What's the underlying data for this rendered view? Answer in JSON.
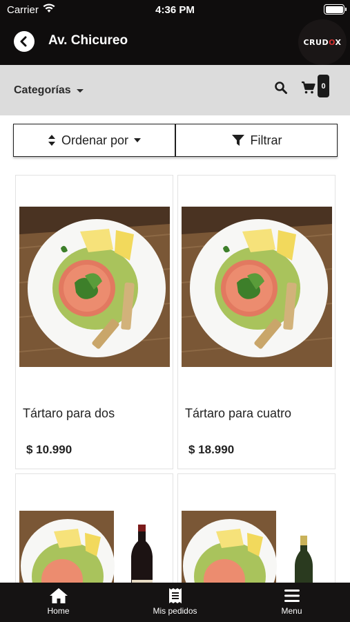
{
  "status": {
    "carrier": "Carrier",
    "time": "4:36 PM"
  },
  "header": {
    "title": "Av. Chicureo",
    "logo_main": "CRUD",
    "logo_accent": "O",
    "logo_end": "X"
  },
  "toolbar": {
    "categories_label": "Categorías",
    "cart_count": "0"
  },
  "actions": {
    "sort_label": "Ordenar por",
    "filter_label": "Filtrar"
  },
  "products": [
    {
      "name": "Tártaro para dos",
      "price": "$ 10.990"
    },
    {
      "name": "Tártaro para cuatro",
      "price": "$ 18.990"
    }
  ],
  "tabs": {
    "home": "Home",
    "orders": "Mis pedidos",
    "menu": "Menu"
  },
  "colors": {
    "bar_dark": "#0f0d0d",
    "category_bar": "#dcdcdc",
    "logo_accent": "#d32f2f"
  },
  "icons": [
    "wifi-icon",
    "battery-icon",
    "back-arrow-icon",
    "search-icon",
    "cart-icon",
    "sort-icon",
    "filter-icon",
    "home-icon",
    "receipt-icon",
    "menu-icon"
  ]
}
